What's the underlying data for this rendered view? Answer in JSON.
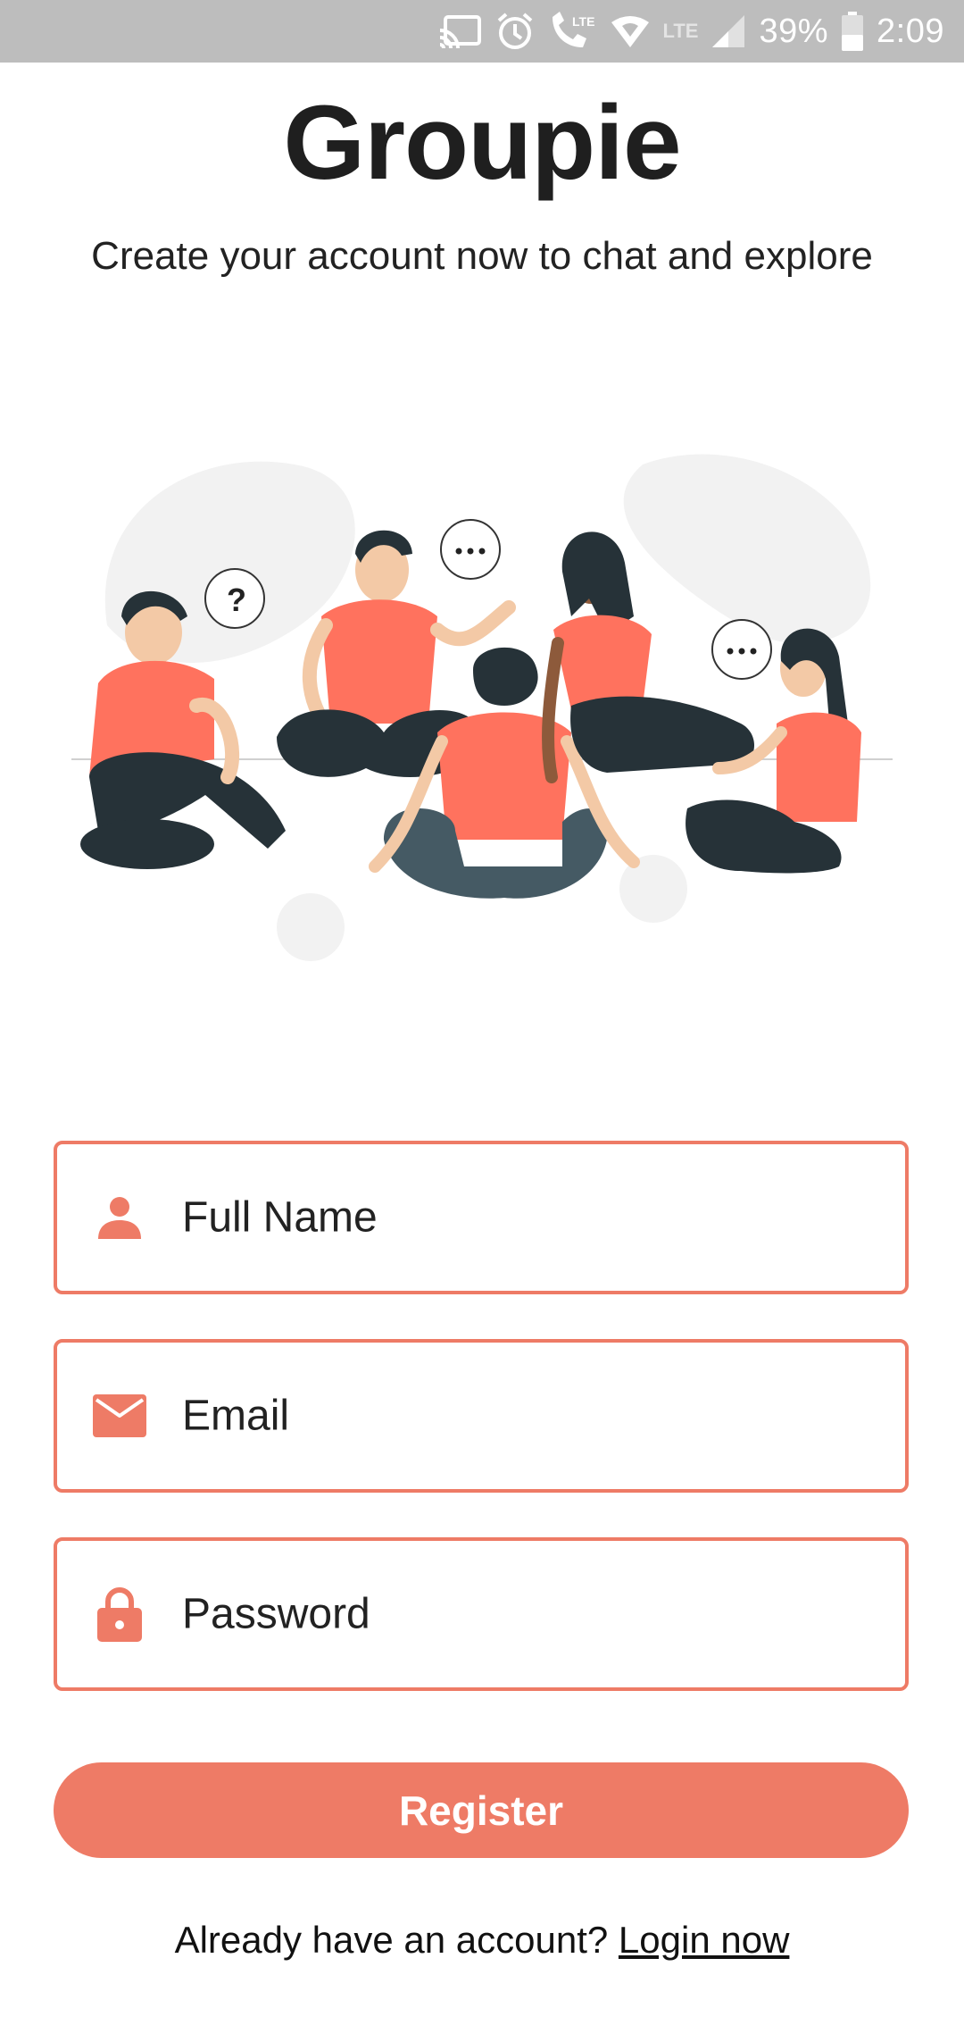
{
  "status_bar": {
    "battery": "39%",
    "time": "2:09",
    "lte_label": "LTE",
    "icons": [
      "cast-icon",
      "alarm-icon",
      "volte-call-icon",
      "wifi-icon",
      "lte-icon",
      "signal-icon",
      "battery-icon"
    ]
  },
  "header": {
    "title": "Groupie",
    "subtitle": "Create your account now to chat and explore"
  },
  "form": {
    "full_name_placeholder": "Full Name",
    "email_placeholder": "Email",
    "password_placeholder": "Password",
    "register_label": "Register"
  },
  "footer": {
    "prompt": "Already have an account?",
    "login_label": "Login now"
  },
  "colors": {
    "accent": "#ee7b66",
    "status_bar": "#bdbdbd",
    "text": "#222222"
  }
}
